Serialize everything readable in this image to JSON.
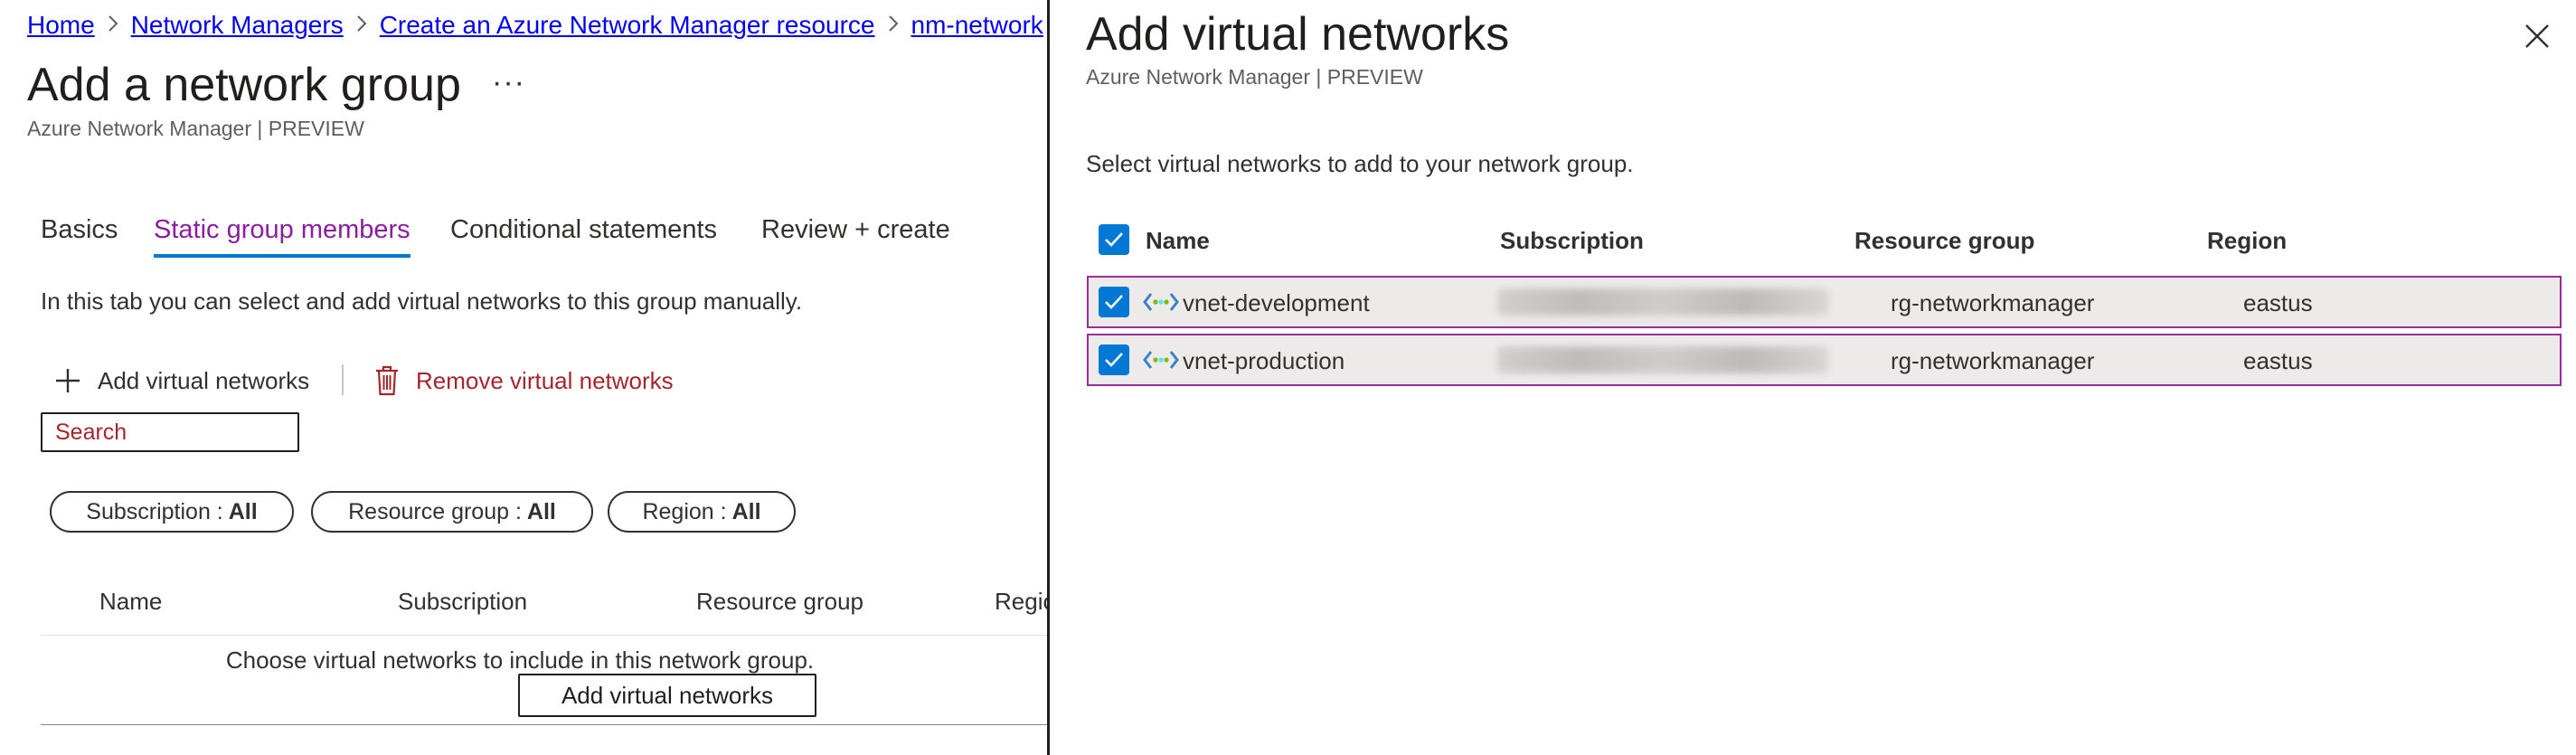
{
  "breadcrumb": {
    "items": [
      "Home",
      "Network Managers",
      "Create an Azure Network Manager resource",
      "nm-network"
    ],
    "separator": ">"
  },
  "page": {
    "title": "Add a network group",
    "more": "···",
    "subtitle": "Azure Network Manager | PREVIEW"
  },
  "tabs": [
    {
      "label": "Basics",
      "active": false
    },
    {
      "label": "Static group members",
      "active": true
    },
    {
      "label": "Conditional statements",
      "active": false
    },
    {
      "label": "Review + create",
      "active": false
    }
  ],
  "intro": "In this tab you can select and add virtual networks to this group manually.",
  "commands": {
    "add_label": "Add virtual networks",
    "remove_label": "Remove virtual networks"
  },
  "search": {
    "placeholder": "Search"
  },
  "filters": [
    {
      "label": "Subscription : ",
      "value": "All"
    },
    {
      "label": "Resource group : ",
      "value": "All"
    },
    {
      "label": "Region : ",
      "value": "All"
    }
  ],
  "left_table": {
    "columns": [
      "Name",
      "Subscription",
      "Resource group",
      "Regio"
    ],
    "empty_message": "Choose virtual networks to include in this network group.",
    "empty_button": "Add virtual networks"
  },
  "panel": {
    "title": "Add virtual networks",
    "subtitle": "Azure Network Manager | PREVIEW",
    "intro": "Select virtual networks to add to your network group.",
    "columns": [
      "Name",
      "Subscription",
      "Resource group",
      "Region"
    ],
    "rows": [
      {
        "name": "vnet-development",
        "resource_group": "rg-networkmanager",
        "region": "eastus",
        "checked": true
      },
      {
        "name": "vnet-production",
        "resource_group": "rg-networkmanager",
        "region": "eastus",
        "checked": true
      }
    ]
  },
  "colors": {
    "accent": "#0078d4",
    "active_tab": "#8a1f9d",
    "danger": "#a4262c",
    "link": "#0000ee",
    "row_selected_border": "#9b2c9b",
    "row_selected_bg": "#edebe9"
  },
  "icons": [
    "chevron-right-icon",
    "more-icon",
    "plus-icon",
    "trash-icon",
    "close-icon",
    "checkmark-icon",
    "virtual-network-icon"
  ]
}
